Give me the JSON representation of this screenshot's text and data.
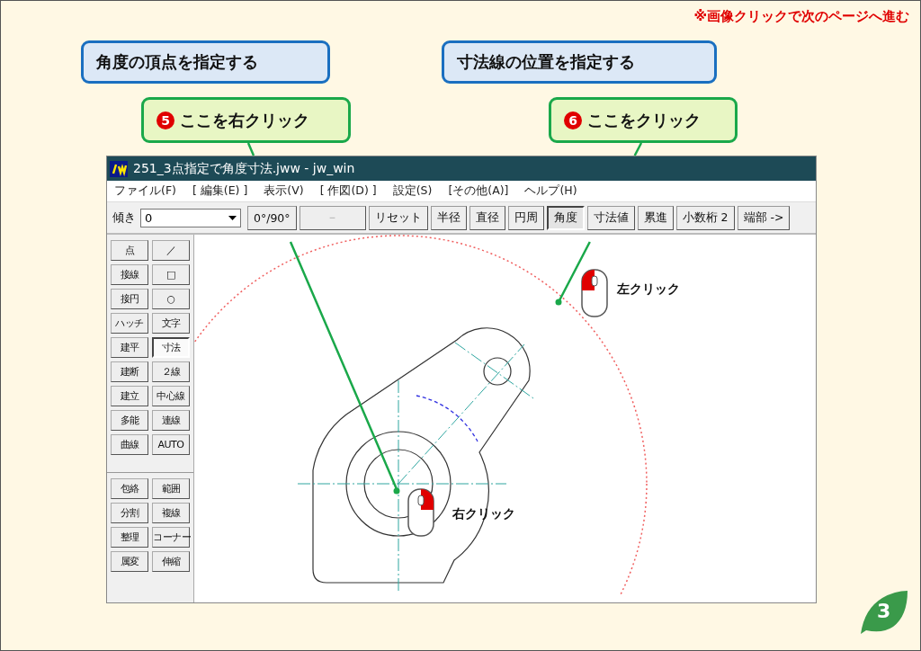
{
  "notice": "※画像クリックで次のページへ進む",
  "instructions": [
    {
      "text": "角度の頂点を指定する"
    },
    {
      "text": "寸法線の位置を指定する"
    }
  ],
  "steps": [
    {
      "number": "5",
      "text": "ここを右クリック"
    },
    {
      "number": "6",
      "text": "ここをクリック"
    }
  ],
  "window": {
    "title": "251_3点指定で角度寸法.jww - jw_win"
  },
  "menu": [
    "ファイル(F)",
    "[ 編集(E) ]",
    "表示(V)",
    "[ 作図(D) ]",
    "設定(S)",
    "[その他(A)]",
    "ヘルプ(H)"
  ],
  "toolbar": {
    "tilt_label": "傾き",
    "tilt_value": "0",
    "buttons": [
      {
        "label": "0°/90°",
        "selected": false,
        "disabled": false
      },
      {
        "label": "－",
        "selected": false,
        "disabled": true
      },
      {
        "label": "リセット",
        "selected": false,
        "disabled": false
      },
      {
        "label": "半径",
        "selected": false,
        "disabled": false
      },
      {
        "label": "直径",
        "selected": false,
        "disabled": false
      },
      {
        "label": "円周",
        "selected": false,
        "disabled": false
      },
      {
        "label": "角度",
        "selected": true,
        "disabled": false
      },
      {
        "label": "寸法値",
        "selected": false,
        "disabled": false
      },
      {
        "label": "累進",
        "selected": false,
        "disabled": false
      },
      {
        "label": "小数桁 2",
        "selected": false,
        "disabled": false
      },
      {
        "label": "端部 ->",
        "selected": false,
        "disabled": false
      }
    ]
  },
  "tool_panel": {
    "upper": [
      [
        {
          "label": "点",
          "selected": false
        },
        {
          "label": "接線",
          "selected": false
        },
        {
          "label": "接円",
          "selected": false
        },
        {
          "label": "ハッチ",
          "selected": false
        },
        {
          "label": "建平",
          "selected": false
        },
        {
          "label": "建断",
          "selected": false
        },
        {
          "label": "建立",
          "selected": false
        },
        {
          "label": "多能",
          "selected": false
        },
        {
          "label": "曲線",
          "selected": false
        }
      ],
      [
        {
          "label": "／",
          "selected": false
        },
        {
          "label": "□",
          "selected": false
        },
        {
          "label": "○",
          "selected": false
        },
        {
          "label": "文字",
          "selected": false
        },
        {
          "label": "寸法",
          "selected": true
        },
        {
          "label": "２線",
          "selected": false
        },
        {
          "label": "中心線",
          "selected": false
        },
        {
          "label": "連線",
          "selected": false
        },
        {
          "label": "AUTO",
          "selected": false
        }
      ]
    ],
    "lower": [
      [
        {
          "label": "包絡",
          "selected": false
        },
        {
          "label": "分割",
          "selected": false
        },
        {
          "label": "整理",
          "selected": false
        },
        {
          "label": "属変",
          "selected": false
        }
      ],
      [
        {
          "label": "範囲",
          "selected": false
        },
        {
          "label": "複線",
          "selected": false
        },
        {
          "label": "コーナー",
          "selected": false
        },
        {
          "label": "伸縮",
          "selected": false
        }
      ]
    ]
  },
  "clicks": [
    {
      "kind": "right",
      "label": "右クリック"
    },
    {
      "kind": "left",
      "label": "左クリック"
    }
  ],
  "page_number": "3"
}
